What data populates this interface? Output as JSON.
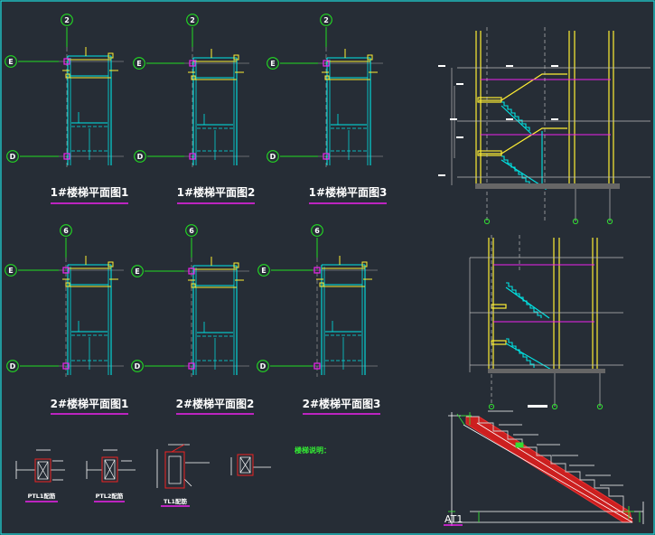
{
  "plans": [
    {
      "title": "1#楼梯平面图1",
      "axis_top": "2",
      "axis_e": "E",
      "axis_d": "D"
    },
    {
      "title": "1#楼梯平面图2",
      "axis_top": "2",
      "axis_e": "E",
      "axis_d": "D"
    },
    {
      "title": "1#楼梯平面图3",
      "axis_top": "2",
      "axis_e": "E",
      "axis_d": "D"
    },
    {
      "title": "2#楼梯平面图1",
      "axis_top": "6",
      "axis_e": "E",
      "axis_d": "D"
    },
    {
      "title": "2#楼梯平面图2",
      "axis_top": "6",
      "axis_e": "E",
      "axis_d": "D"
    },
    {
      "title": "2#楼梯平面图3",
      "axis_top": "6",
      "axis_e": "E",
      "axis_d": "D"
    }
  ],
  "details": [
    {
      "label": "PTL1配筋"
    },
    {
      "label": "PTL2配筋"
    },
    {
      "label": "TL1配筋"
    }
  ],
  "stair_note": "楼梯说明：",
  "at1_label": "AT1",
  "colors": {
    "background": "#262d36",
    "cyan": "#00e5e5",
    "yellow": "#ffee33",
    "magenta": "#ee22ee",
    "green": "#22dd22",
    "red": "#ee2222",
    "white": "#ffffff"
  }
}
